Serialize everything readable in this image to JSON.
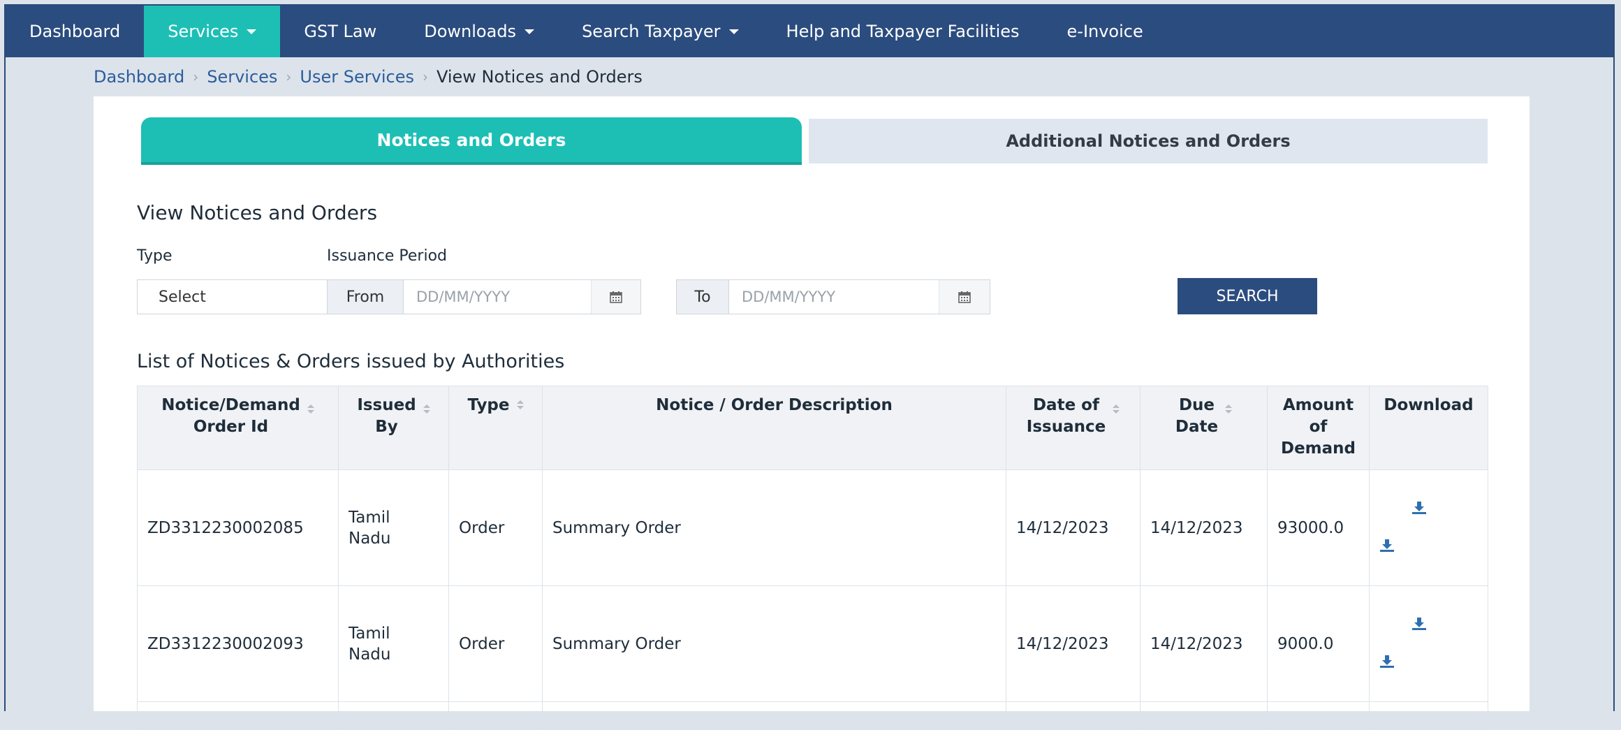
{
  "nav": {
    "items": [
      {
        "label": "Dashboard",
        "dropdown": false,
        "active": false
      },
      {
        "label": "Services",
        "dropdown": true,
        "active": true
      },
      {
        "label": "GST Law",
        "dropdown": false,
        "active": false
      },
      {
        "label": "Downloads",
        "dropdown": true,
        "active": false
      },
      {
        "label": "Search Taxpayer",
        "dropdown": true,
        "active": false
      },
      {
        "label": "Help and Taxpayer Facilities",
        "dropdown": false,
        "active": false
      },
      {
        "label": "e-Invoice",
        "dropdown": false,
        "active": false
      }
    ]
  },
  "breadcrumb": {
    "items": [
      "Dashboard",
      "Services",
      "User Services"
    ],
    "current": "View Notices and Orders"
  },
  "tabs": {
    "active": "Notices and Orders",
    "inactive": "Additional Notices and Orders"
  },
  "filters": {
    "title": "View Notices and Orders",
    "type_label": "Type",
    "type_value": "Select",
    "period_label": "Issuance Period",
    "from_label": "From",
    "from_placeholder": "DD/MM/YYYY",
    "to_label": "To",
    "to_placeholder": "DD/MM/YYYY",
    "search_label": "SEARCH"
  },
  "table": {
    "title": "List of Notices & Orders issued by Authorities",
    "headers": [
      {
        "line1": "Notice/Demand",
        "line2": "Order Id",
        "line3": ""
      },
      {
        "line1": "Issued",
        "line2": "By",
        "line3": ""
      },
      {
        "line1": "Type",
        "line2": "",
        "line3": ""
      },
      {
        "line1": "Notice / Order Description",
        "line2": "",
        "line3": ""
      },
      {
        "line1": "Date of",
        "line2": "Issuance",
        "line3": ""
      },
      {
        "line1": "Due",
        "line2": "Date",
        "line3": ""
      },
      {
        "line1": "Amount",
        "line2": "of",
        "line3": "Demand"
      },
      {
        "line1": "Download",
        "line2": "",
        "line3": ""
      }
    ],
    "rows": [
      {
        "id": "ZD3312230002085",
        "issued_by_1": "Tamil",
        "issued_by_2": "Nadu",
        "type": "Order",
        "description": "Summary Order",
        "date_of_issuance": "14/12/2023",
        "due_date": "14/12/2023",
        "amount": "93000.0"
      },
      {
        "id": "ZD3312230002093",
        "issued_by_1": "Tamil",
        "issued_by_2": "Nadu",
        "type": "Order",
        "description": "Summary Order",
        "date_of_issuance": "14/12/2023",
        "due_date": "14/12/2023",
        "amount": "9000.0"
      }
    ]
  },
  "colors": {
    "nav_bg": "#2b4c7e",
    "accent_teal": "#1dbfb5",
    "link_blue": "#2b5d9c",
    "download_icon": "#2e6fb0"
  },
  "icons": {
    "calendar": "calendar-icon",
    "download": "download-icon",
    "sort": "sort-icon",
    "caret": "caret-down-icon"
  }
}
